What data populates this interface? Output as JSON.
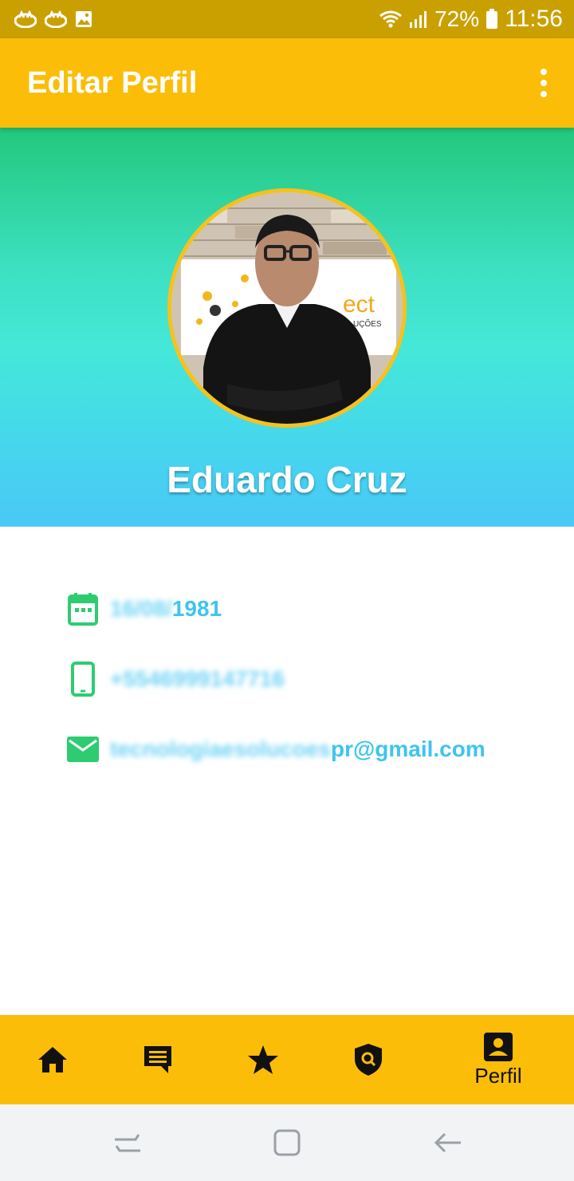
{
  "status_bar": {
    "battery": "72%",
    "time": "11:56",
    "icons": [
      "notification-icon",
      "notification-icon",
      "image-icon",
      "wifi-icon",
      "signal-icon",
      "battery-icon"
    ]
  },
  "app_bar": {
    "title": "Editar Perfil",
    "menu_icon": "more-vert-icon"
  },
  "profile": {
    "name": "Eduardo Cruz",
    "avatar_icon": "profile-photo",
    "colors": {
      "gradient_top": "#22c87c",
      "gradient_mid": "#44e8d8",
      "gradient_bottom": "#4ac8f6",
      "avatar_border": "#f7c11c"
    }
  },
  "info": {
    "birthdate_hidden": "16/08/",
    "birthdate_visible": "1981",
    "phone_hidden": "+5546999147716",
    "email_hidden": "tecnologiaesolucoes",
    "email_visible": "pr@gmail.com"
  },
  "bottom_nav": {
    "items": [
      {
        "icon": "home-icon",
        "label": ""
      },
      {
        "icon": "chat-icon",
        "label": ""
      },
      {
        "icon": "star-icon",
        "label": ""
      },
      {
        "icon": "shield-search-icon",
        "label": ""
      },
      {
        "icon": "account-box-icon",
        "label": "Perfil"
      }
    ],
    "background": "#fbbd08"
  },
  "system_nav": {
    "buttons": [
      "recents-icon",
      "home-square-icon",
      "back-icon"
    ]
  },
  "colors": {
    "status_bar": "#c9a000",
    "accent": "#fbbd08",
    "icon_green": "#2ecc71",
    "link_blue": "#3ec4f0"
  }
}
